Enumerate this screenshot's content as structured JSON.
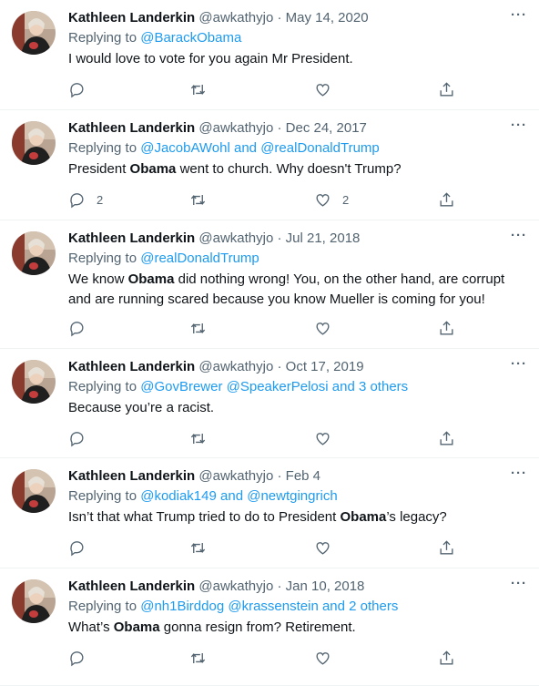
{
  "user": {
    "name": "Kathleen Landerkin",
    "handle": "@awkathyjo",
    "separator": "·",
    "more": "···"
  },
  "tweets": [
    {
      "date": "May 14, 2020",
      "reply_prefix": "Replying to ",
      "mentions": [
        "@BarackObama"
      ],
      "text": [
        {
          "t": "I would love to vote for you again Mr President."
        }
      ],
      "reply_count": "",
      "like_count": ""
    },
    {
      "date": "Dec 24, 2017",
      "reply_prefix": "Replying to ",
      "mentions": [
        "@JacobAWohl",
        " and ",
        "@realDonaldTrump"
      ],
      "text": [
        {
          "t": "President "
        },
        {
          "t": "Obama",
          "b": true
        },
        {
          "t": " went to church. Why doesn't Trump?"
        }
      ],
      "reply_count": "2",
      "like_count": "2"
    },
    {
      "date": "Jul 21, 2018",
      "reply_prefix": "Replying to ",
      "mentions": [
        "@realDonaldTrump"
      ],
      "text": [
        {
          "t": "We know "
        },
        {
          "t": "Obama",
          "b": true
        },
        {
          "t": " did nothing wrong!  You, on the other hand, are corrupt and are running scared because you know Mueller is coming for you!"
        }
      ],
      "reply_count": "",
      "like_count": ""
    },
    {
      "date": "Oct 17, 2019",
      "reply_prefix": "Replying to ",
      "mentions": [
        "@GovBrewer",
        " ",
        "@SpeakerPelosi",
        " and 3 others"
      ],
      "text": [
        {
          "t": "Because you’re a racist."
        }
      ],
      "reply_count": "",
      "like_count": ""
    },
    {
      "date": "Feb 4",
      "reply_prefix": "Replying to ",
      "mentions": [
        "@kodiak149",
        " and ",
        "@newtgingrich"
      ],
      "text": [
        {
          "t": "Isn’t that what Trump tried to do to President "
        },
        {
          "t": "Obama",
          "b": true
        },
        {
          "t": "’s legacy?"
        }
      ],
      "reply_count": "",
      "like_count": ""
    },
    {
      "date": "Jan 10, 2018",
      "reply_prefix": "Replying to ",
      "mentions": [
        "@nh1Birddog",
        " ",
        "@krassenstein",
        " and 2 others"
      ],
      "text": [
        {
          "t": "What’s "
        },
        {
          "t": "Obama",
          "b": true
        },
        {
          "t": " gonna resign from? Retirement."
        }
      ],
      "reply_count": "",
      "like_count": ""
    }
  ],
  "icons": {
    "reply": "reply-icon",
    "retweet": "retweet-icon",
    "like": "heart-icon",
    "share": "share-icon",
    "more": "more-icon"
  },
  "colors": {
    "link": "#1d9bf0",
    "muted": "#536471",
    "text": "#0f1419",
    "divider": "#eff3f4"
  }
}
